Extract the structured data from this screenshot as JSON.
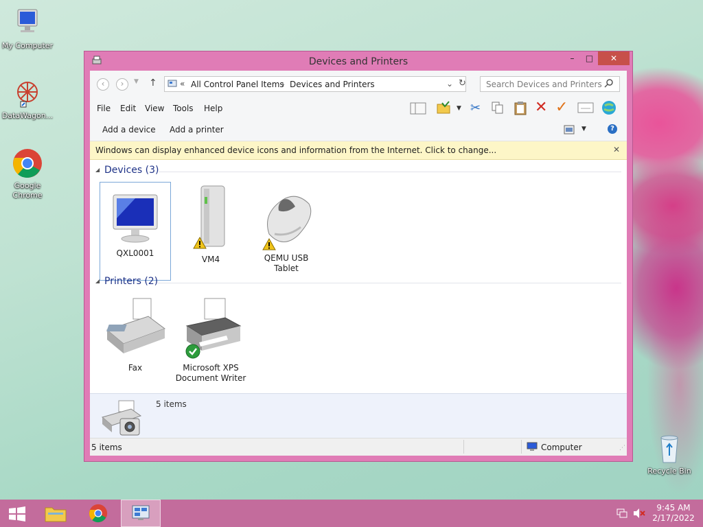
{
  "desktop": {
    "icons": [
      {
        "label": "My Computer"
      },
      {
        "label": "DataWagon..."
      },
      {
        "label": "Google Chrome"
      },
      {
        "label": "Recycle Bin"
      }
    ]
  },
  "window": {
    "title": "Devices and Printers",
    "controls": {
      "minimize": "–",
      "maximize": "□",
      "close": "✕"
    }
  },
  "address": {
    "overflow": "«",
    "crumbs": [
      "All Control Panel Items",
      "Devices and Printers"
    ],
    "search_placeholder": "Search Devices and Printers"
  },
  "menu": [
    "File",
    "Edit",
    "View",
    "Tools",
    "Help"
  ],
  "commands": {
    "add_device": "Add a device",
    "add_printer": "Add a printer"
  },
  "infobar": {
    "text": "Windows can display enhanced device icons and information from the Internet. Click to change...",
    "close": "✕"
  },
  "devices": {
    "heading": "Devices (3)",
    "items": [
      {
        "name": "QXL0001",
        "warning": false
      },
      {
        "name": "VM4",
        "warning": true
      },
      {
        "name": "QEMU USB Tablet",
        "warning": true
      }
    ]
  },
  "printers": {
    "heading": "Printers (2)",
    "items": [
      {
        "name": "Fax",
        "default": false
      },
      {
        "name": "Microsoft XPS Document Writer",
        "default": true
      }
    ]
  },
  "details": {
    "count": "5 items"
  },
  "status": {
    "left": "5 items",
    "right": "Computer"
  },
  "tray": {
    "time": "9:45 AM",
    "date": "2/17/2022"
  },
  "colors": {
    "window_border": "#e07cb6",
    "taskbar": "#c36c9c",
    "close": "#c7504a",
    "link": "#1e3287"
  }
}
